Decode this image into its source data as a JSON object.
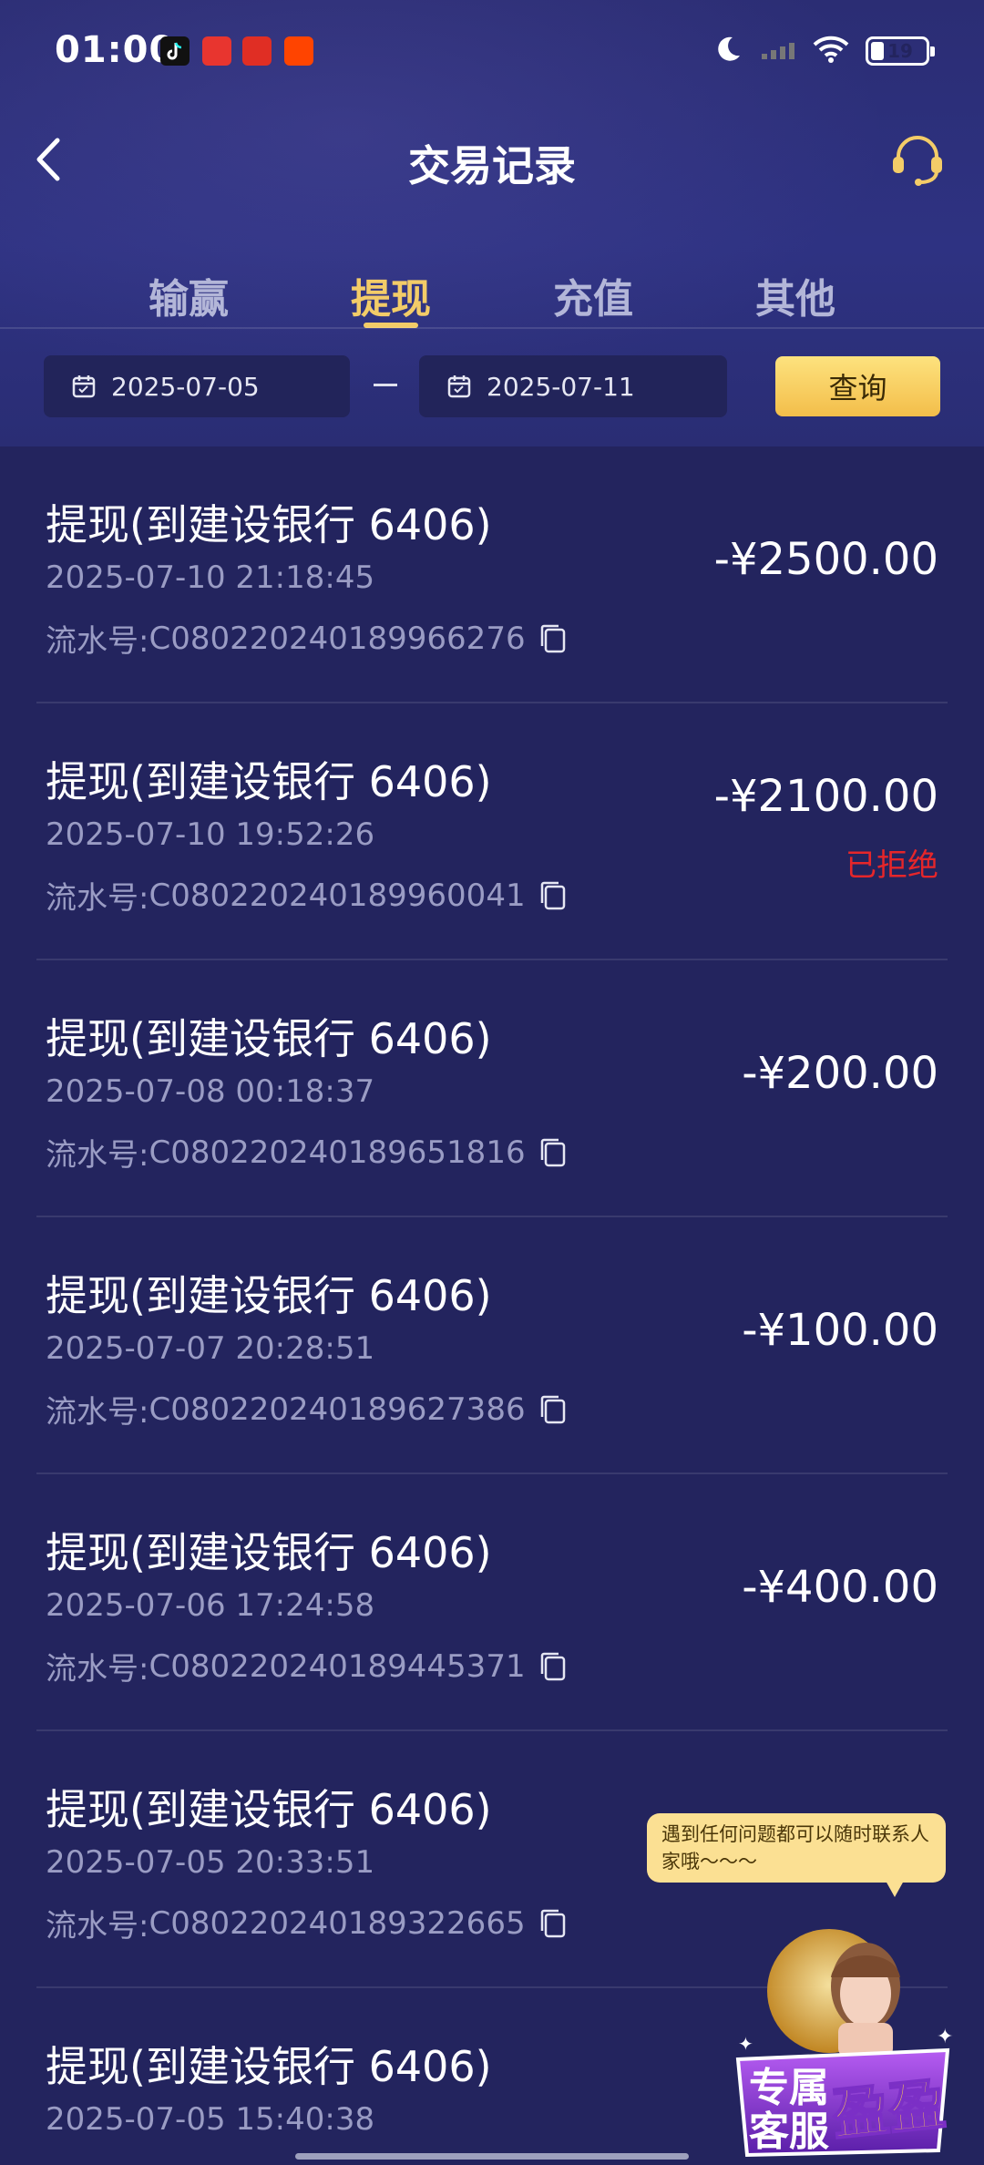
{
  "status_bar": {
    "time": "01:00",
    "battery": "19",
    "app_icons": [
      "tiktok-icon",
      "toutiao-icon",
      "pinduoduo-icon",
      "taobao-icon"
    ]
  },
  "header": {
    "title": "交易记录"
  },
  "tabs": [
    {
      "label": "输赢",
      "active": false
    },
    {
      "label": "提现",
      "active": true
    },
    {
      "label": "充值",
      "active": false
    },
    {
      "label": "其他",
      "active": false
    }
  ],
  "filter": {
    "start_date": "2025-07-05",
    "end_date": "2025-07-11",
    "query_label": "查询"
  },
  "transactions": [
    {
      "title": "提现(到建设银行 6406)",
      "time": "2025-07-10 21:18:45",
      "serial_label": "流水号: ",
      "serial": "C08022024018996627​6",
      "amount": "-¥2500.00",
      "status": ""
    },
    {
      "title": "提现(到建设银行 6406)",
      "time": "2025-07-10 19:52:26",
      "serial_label": "流水号: ",
      "serial": "C080220240189960041",
      "amount": "-¥2100.00",
      "status": "已拒绝"
    },
    {
      "title": "提现(到建设银行 6406)",
      "time": "2025-07-08 00:18:37",
      "serial_label": "流水号: ",
      "serial": "C080220240189651816",
      "amount": "-¥200.00",
      "status": ""
    },
    {
      "title": "提现(到建设银行 6406)",
      "time": "2025-07-07 20:28:51",
      "serial_label": "流水号: ",
      "serial": "C080220240189627386",
      "amount": "-¥100.00",
      "status": ""
    },
    {
      "title": "提现(到建设银行 6406)",
      "time": "2025-07-06 17:24:58",
      "serial_label": "流水号: ",
      "serial": "C080220240189445371",
      "amount": "-¥400.00",
      "status": ""
    },
    {
      "title": "提现(到建设银行 6406)",
      "time": "2025-07-05 20:33:51",
      "serial_label": "流水号: ",
      "serial": "C080220240189322665",
      "amount": "",
      "status": ""
    },
    {
      "title": "提现(到建设银行 6406)",
      "time": "2025-07-05 15:40:38",
      "serial_label": "",
      "serial": "",
      "amount": "",
      "status": ""
    }
  ],
  "service_widget": {
    "tooltip": "遇到任何问题都可以随时联系人家哦～～～",
    "badge_line1": "专属",
    "badge_line2": "客服",
    "badge_name": "盈盈"
  },
  "colors": {
    "background": "#23245e",
    "accent": "#f3cc68",
    "rejected": "#e6262a"
  }
}
